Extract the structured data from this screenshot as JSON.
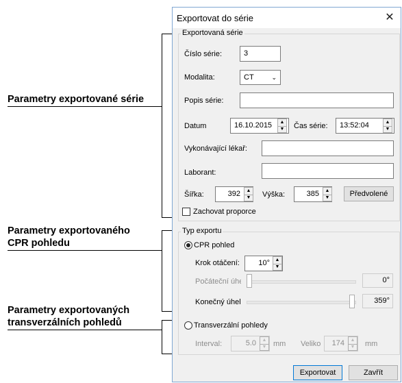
{
  "annotations": {
    "series_params": "Parametry exportované série",
    "cpr_params_line1": "Parametry exportovaného",
    "cpr_params_line2": "CPR pohledu",
    "transversal_params_line1": "Parametry exportovaných",
    "transversal_params_line2": "transverzálních pohledů"
  },
  "dialog": {
    "title": "Exportovat do série",
    "close": "✕"
  },
  "series_group": {
    "title": "Exportovaná série",
    "series_number_label": "Číslo série:",
    "series_number_value": "3",
    "modality_label": "Modalita:",
    "modality_value": "CT",
    "description_label": "Popis série:",
    "description_value": "",
    "date_label": "Datum",
    "date_value": "16.10.2015",
    "time_label": "Čas série:",
    "time_value": "13:52:04",
    "physician_label": "Vykonávající lékař:",
    "physician_value": "",
    "technician_label": "Laborant:",
    "technician_value": "",
    "width_label": "Šířka:",
    "width_value": "392",
    "height_label": "Výška:",
    "height_value": "385",
    "presets_button": "Předvolené",
    "keep_ratio_label": "Zachovat proporce",
    "keep_ratio_checked": false
  },
  "export_type_group": {
    "title": "Typ exportu",
    "cpr_radio_label": "CPR pohled",
    "cpr_selected": true,
    "rotation_step_label": "Krok otáčení:",
    "rotation_step_value": "10°",
    "start_angle_label": "Počáteční úhe",
    "start_angle_value": "0°",
    "start_angle_fraction": 0.0,
    "end_angle_label": "Konečný úhel",
    "end_angle_value": "359°",
    "end_angle_fraction": 1.0,
    "transversal_radio_label": "Transverzální pohledy",
    "transversal_selected": false,
    "interval_label": "Interval:",
    "interval_value": "5.0",
    "interval_unit": "mm",
    "size_label": "Veliko",
    "size_value": "174",
    "size_unit": "mm"
  },
  "buttons": {
    "export": "Exportovat",
    "close": "Zavřít"
  }
}
